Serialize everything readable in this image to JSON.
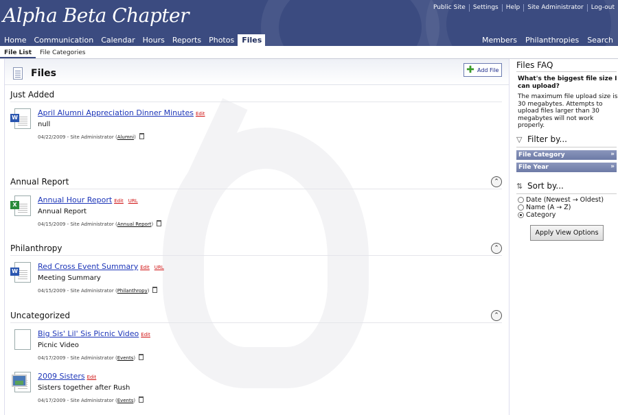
{
  "header": {
    "logo": "Alpha Beta Chapter",
    "top_links": [
      "Public Site",
      "Settings",
      "Help",
      "Site Administrator",
      "Log-out"
    ],
    "nav": [
      "Home",
      "Communication",
      "Calendar",
      "Hours",
      "Reports",
      "Photos",
      "Files"
    ],
    "nav_active": "Files",
    "nav_right": [
      "Members",
      "Philanthropies",
      "Search"
    ]
  },
  "subtabs": [
    "File List",
    "File Categories"
  ],
  "page": {
    "title": "Files",
    "add_file_label": "Add File"
  },
  "sections": [
    {
      "title": "Just Added",
      "collapsible": false,
      "items": [
        {
          "name": "April Alumni Appreciation Dinner Minutes",
          "type": "word-icon",
          "actions": [
            "Edit"
          ],
          "description": "null",
          "meta": "04/22/2009 - Site Administrator",
          "category": "Alumni"
        }
      ]
    },
    {
      "title": "Annual Report",
      "collapsible": true,
      "items": [
        {
          "name": "Annual Hour Report",
          "type": "excel-icon",
          "actions": [
            "Edit",
            "URL"
          ],
          "description": "Annual Report",
          "meta": "04/15/2009 - Site Administrator",
          "category": "Annual Report"
        }
      ]
    },
    {
      "title": "Philanthropy",
      "collapsible": true,
      "items": [
        {
          "name": "Red Cross Event Summary",
          "type": "word-icon",
          "actions": [
            "Edit",
            "URL"
          ],
          "description": "Meeting Summary",
          "meta": "04/15/2009 - Site Administrator",
          "category": "Philanthropy"
        }
      ]
    },
    {
      "title": "Uncategorized",
      "collapsible": true,
      "items": [
        {
          "name": "Big Sis' Lil' Sis Picnic Video",
          "type": "blank-file-icon",
          "actions": [
            "Edit"
          ],
          "description": "Picnic Video",
          "meta": "04/17/2009 - Site Administrator",
          "category": "Events"
        },
        {
          "name": "2009 Sisters",
          "type": "image-file-icon",
          "actions": [
            "Edit"
          ],
          "description": "Sisters together after Rush",
          "meta": "04/17/2009 - Site Administrator",
          "category": "Events"
        }
      ]
    }
  ],
  "sidebar": {
    "faq_title": "Files FAQ",
    "faq_question": "What's the biggest file size I can upload?",
    "faq_answer": "The maximum file upload size is 30 megabytes. Attempts to upload files larger than 30 megabytes will not work properly.",
    "filter_title": "Filter by...",
    "filters": [
      "File Category",
      "File Year"
    ],
    "sort_title": "Sort by...",
    "sort_options": [
      {
        "label": "Date (Newest → Oldest)",
        "selected": false
      },
      {
        "label": "Name (A → Z)",
        "selected": false
      },
      {
        "label": "Category",
        "selected": true
      }
    ],
    "apply_label": "Apply View Options"
  },
  "colors": {
    "header": "#3b4b80",
    "link": "#1c35b8",
    "action_link": "#d01010"
  }
}
